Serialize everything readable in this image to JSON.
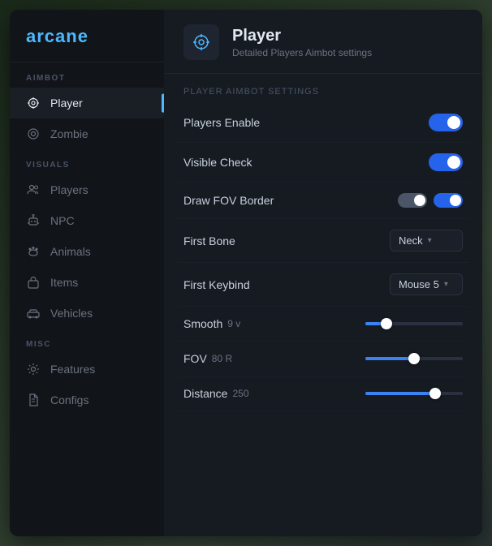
{
  "app": {
    "logo": "arcane",
    "bg": "#2a3a2a"
  },
  "sidebar": {
    "sections": [
      {
        "label": "AIMBOT",
        "items": [
          {
            "id": "player",
            "label": "Player",
            "icon": "crosshair",
            "active": true
          },
          {
            "id": "zombie",
            "label": "Zombie",
            "icon": "target",
            "active": false
          }
        ]
      },
      {
        "label": "VISUALS",
        "items": [
          {
            "id": "players",
            "label": "Players",
            "icon": "users",
            "active": false
          },
          {
            "id": "npc",
            "label": "NPC",
            "icon": "robot",
            "active": false
          },
          {
            "id": "animals",
            "label": "Animals",
            "icon": "paw",
            "active": false
          },
          {
            "id": "items",
            "label": "Items",
            "icon": "bag",
            "active": false
          },
          {
            "id": "vehicles",
            "label": "Vehicles",
            "icon": "car",
            "active": false
          }
        ]
      },
      {
        "label": "MISC",
        "items": [
          {
            "id": "features",
            "label": "Features",
            "icon": "gear",
            "active": false
          },
          {
            "id": "configs",
            "label": "Configs",
            "icon": "file",
            "active": false
          }
        ]
      }
    ]
  },
  "page": {
    "title": "Player",
    "subtitle": "Detailed Players Aimbot settings",
    "settings_section_label": "Player Aimbot Settings",
    "settings": [
      {
        "id": "players_enable",
        "label": "Players Enable",
        "type": "toggle",
        "value": true
      },
      {
        "id": "visible_check",
        "label": "Visible Check",
        "type": "toggle",
        "value": true
      },
      {
        "id": "draw_fov_border",
        "label": "Draw FOV Border",
        "type": "dual_toggle",
        "value_gray": true,
        "value_blue": true
      },
      {
        "id": "first_bone",
        "label": "First Bone",
        "type": "dropdown",
        "value": "Neck"
      },
      {
        "id": "first_keybind",
        "label": "First Keybind",
        "type": "dropdown",
        "value": "Mouse 5"
      },
      {
        "id": "smooth",
        "label": "Smooth",
        "inline_value": "9",
        "inline_unit": "v",
        "type": "slider",
        "fill_pct": 22,
        "thumb_pct": 22
      },
      {
        "id": "fov",
        "label": "FOV",
        "inline_value": "80",
        "inline_unit": "R",
        "type": "slider",
        "fill_pct": 50,
        "thumb_pct": 50
      },
      {
        "id": "distance",
        "label": "Distance",
        "inline_value": "250",
        "inline_unit": "",
        "type": "slider",
        "fill_pct": 72,
        "thumb_pct": 72
      }
    ]
  },
  "icons": {
    "crosshair": "⊕",
    "target": "◎",
    "users": "👥",
    "robot": "🤖",
    "paw": "🐾",
    "bag": "🧳",
    "car": "🚗",
    "gear": "⚙",
    "file": "📄",
    "chevron_down": "▾"
  }
}
